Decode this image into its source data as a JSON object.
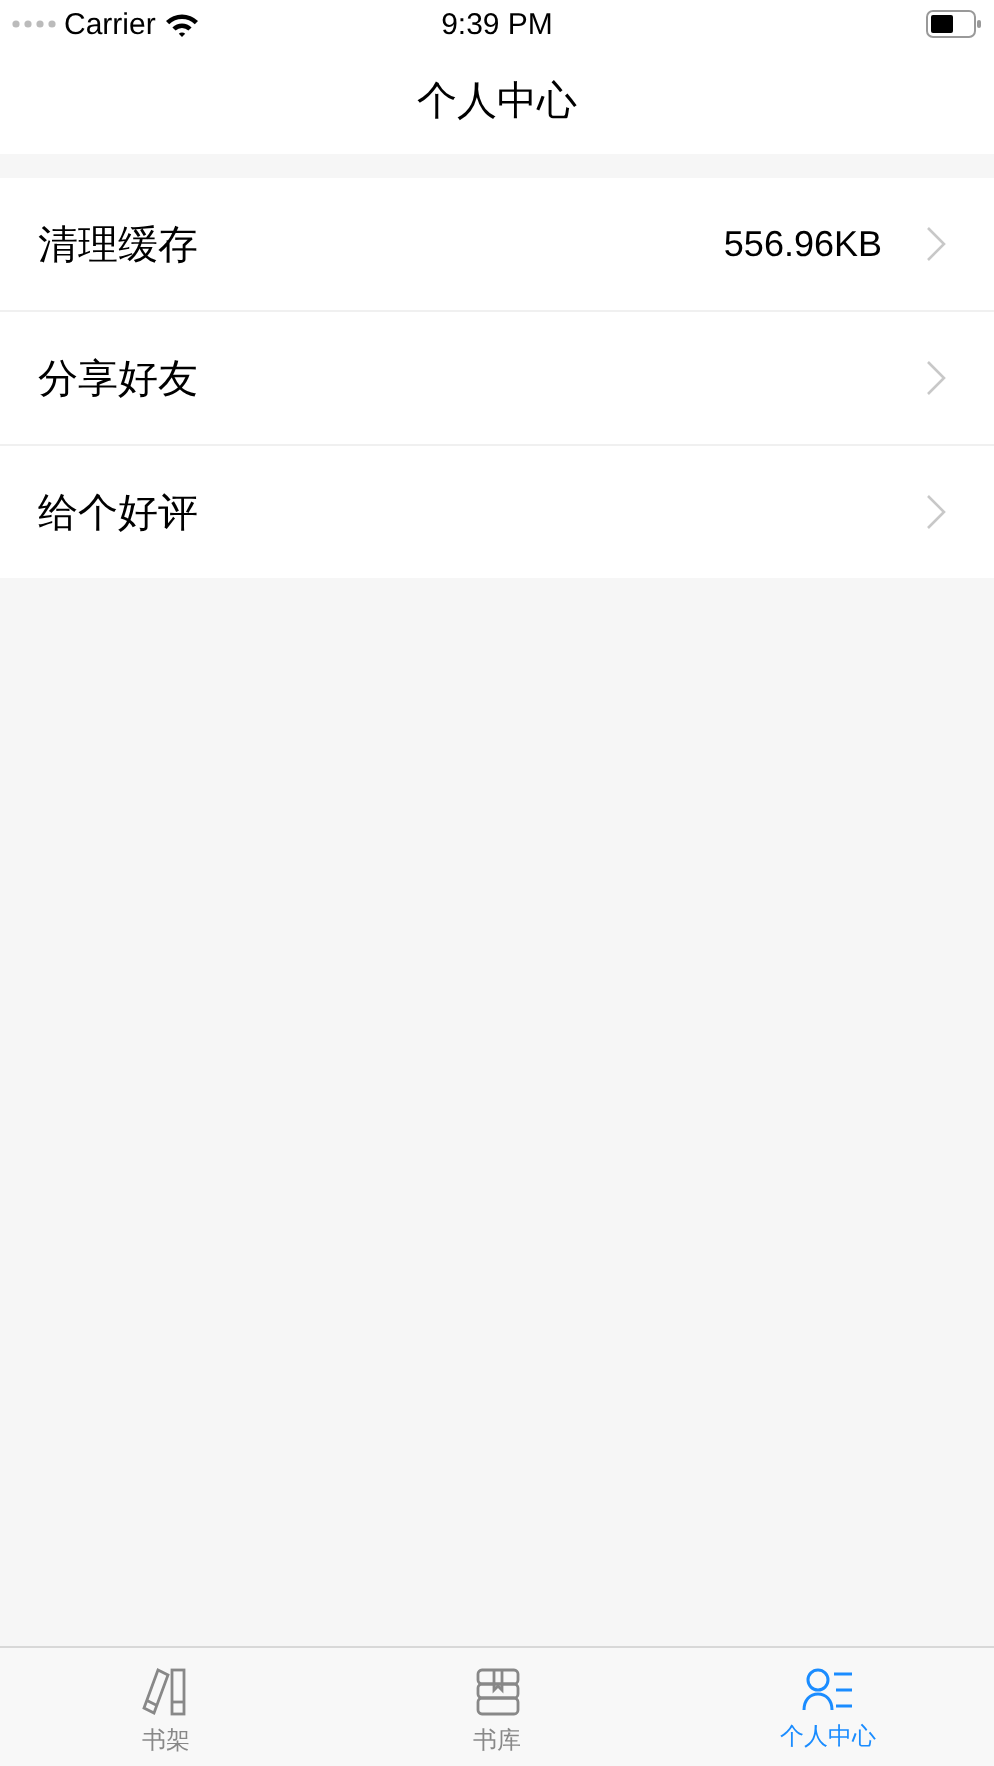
{
  "status_bar": {
    "carrier": "Carrier",
    "time": "9:39 PM"
  },
  "nav_bar": {
    "title": "个人中心"
  },
  "settings": [
    {
      "label": "清理缓存",
      "value": "556.96KB"
    },
    {
      "label": "分享好友"
    },
    {
      "label": "给个好评"
    }
  ],
  "tab_bar": [
    {
      "label": "书架",
      "kind": "shelf",
      "selected": false
    },
    {
      "label": "书库",
      "kind": "library",
      "selected": false
    },
    {
      "label": "个人中心",
      "kind": "profile",
      "selected": true
    }
  ]
}
